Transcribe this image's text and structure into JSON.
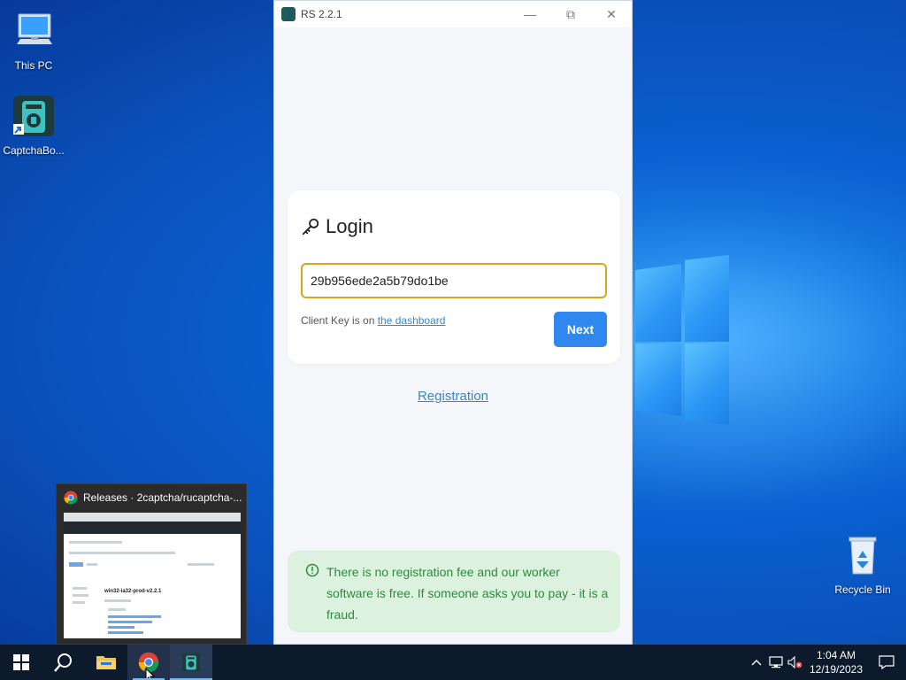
{
  "desktop": {
    "icons": [
      {
        "label": "This PC",
        "icon": "this-pc-icon"
      },
      {
        "label": "CaptchaBo...",
        "icon": "captchabot-icon"
      },
      {
        "label": "Recycle Bin",
        "icon": "recycle-bin-icon"
      }
    ]
  },
  "window": {
    "title": "RS 2.2.1",
    "controls": {
      "minimize": "—",
      "restore": "⧉",
      "close": "✕"
    },
    "login": {
      "heading": "Login",
      "key_value": "29b956ede2a5b79do1be",
      "hint_prefix": "Client Key is on ",
      "hint_link": "the dashboard",
      "next_label": "Next"
    },
    "registration_label": "Registration",
    "notice": "There is no registration fee and our worker software is free. If someone asks you to pay - it is a fraud."
  },
  "preview": {
    "title": "Releases · 2captcha/rucaptcha-...",
    "release_heading": "win32-ia32-prod-v2.2.1"
  },
  "taskbar": {
    "time": "1:04 AM",
    "date": "12/19/2023"
  },
  "colors": {
    "accent_button": "#2f87f0",
    "input_border_focus": "#e0a21a",
    "link": "#3a86c9",
    "notice_bg": "#dcf2df",
    "notice_text": "#2e8a3e"
  }
}
